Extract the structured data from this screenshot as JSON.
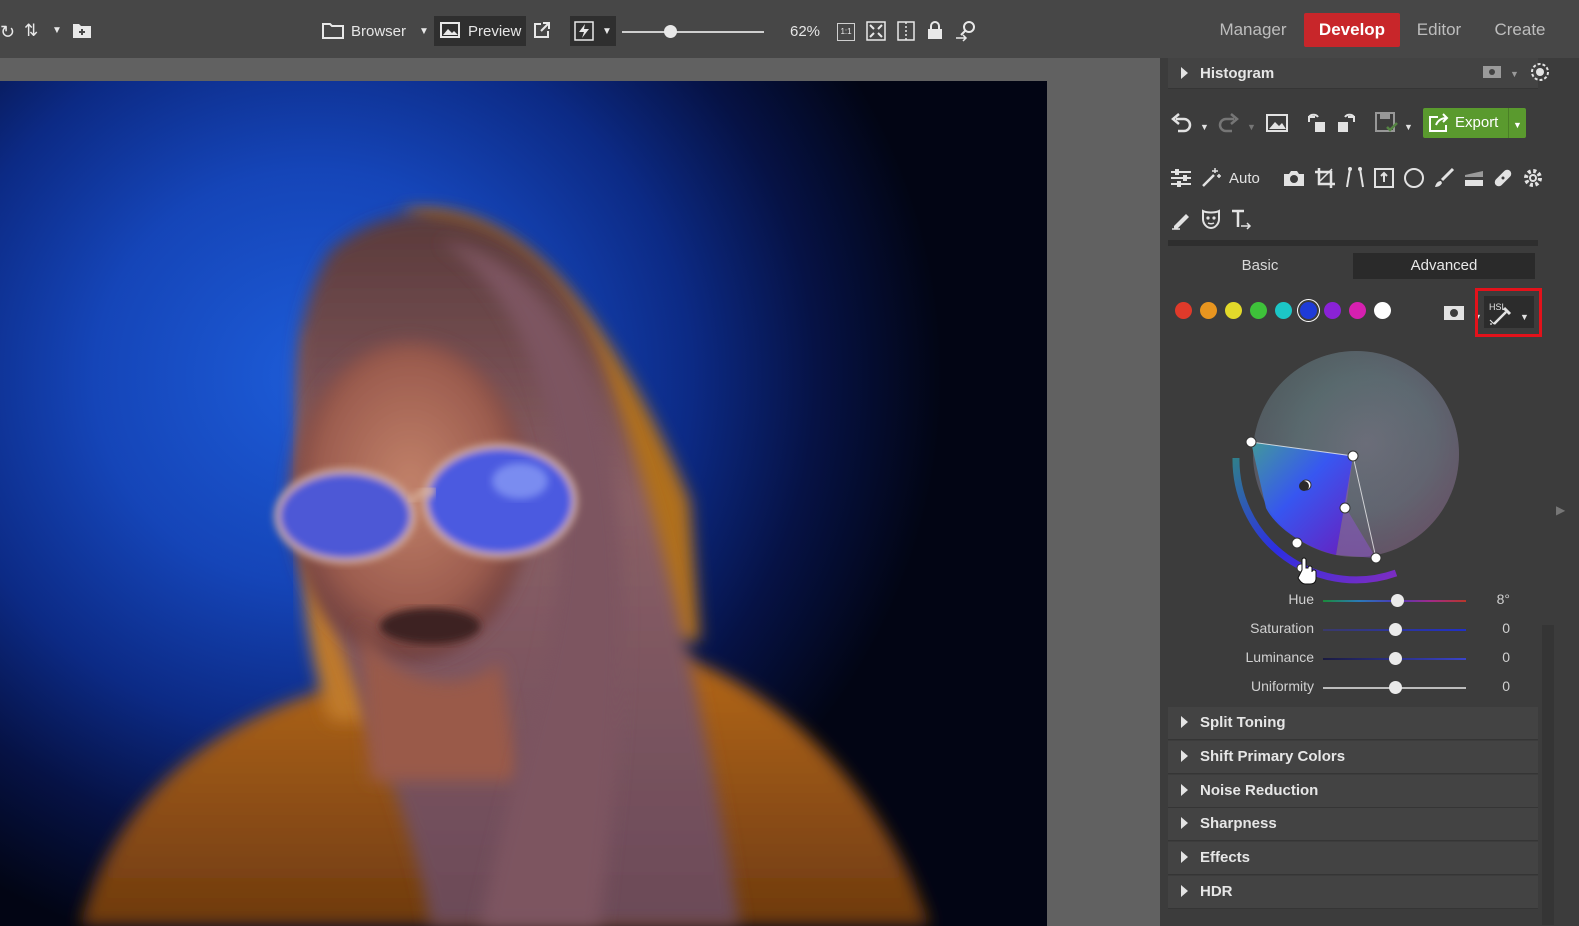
{
  "toolbar": {
    "browser_label": "Browser",
    "preview_label": "Preview",
    "zoom_value": "62%",
    "zoom_fraction": 0.34,
    "one_to_one": "1:1"
  },
  "modes": [
    {
      "label": "Manager"
    },
    {
      "label": "Develop"
    },
    {
      "label": "Editor"
    },
    {
      "label": "Create"
    }
  ],
  "panel": {
    "histogram_label": "Histogram",
    "auto_label": "Auto",
    "export_label": "Export",
    "tabs": {
      "basic": "Basic",
      "advanced": "Advanced"
    },
    "color_swatches": [
      {
        "name": "red",
        "color": "#e03a2a"
      },
      {
        "name": "orange",
        "color": "#e8951f"
      },
      {
        "name": "yellow",
        "color": "#e2d92a"
      },
      {
        "name": "green",
        "color": "#3ec23a"
      },
      {
        "name": "aqua",
        "color": "#1cc6c6"
      },
      {
        "name": "blue",
        "color": "#1e3bd8"
      },
      {
        "name": "purple",
        "color": "#8a22d6"
      },
      {
        "name": "magenta",
        "color": "#d620b0"
      },
      {
        "name": "white",
        "color": "#ffffff"
      }
    ],
    "hsl_tool_label": "HSL",
    "adjustments": [
      {
        "label": "Hue",
        "value": "8°",
        "position": 0.52
      },
      {
        "label": "Saturation",
        "value": "0",
        "position": 0.5
      },
      {
        "label": "Luminance",
        "value": "0",
        "position": 0.5
      },
      {
        "label": "Uniformity",
        "value": "0",
        "position": 0.5
      }
    ],
    "sections": [
      {
        "label": "Split Toning"
      },
      {
        "label": "Shift Primary Colors"
      },
      {
        "label": "Noise Reduction"
      },
      {
        "label": "Sharpness"
      },
      {
        "label": "Effects"
      },
      {
        "label": "HDR"
      }
    ]
  }
}
